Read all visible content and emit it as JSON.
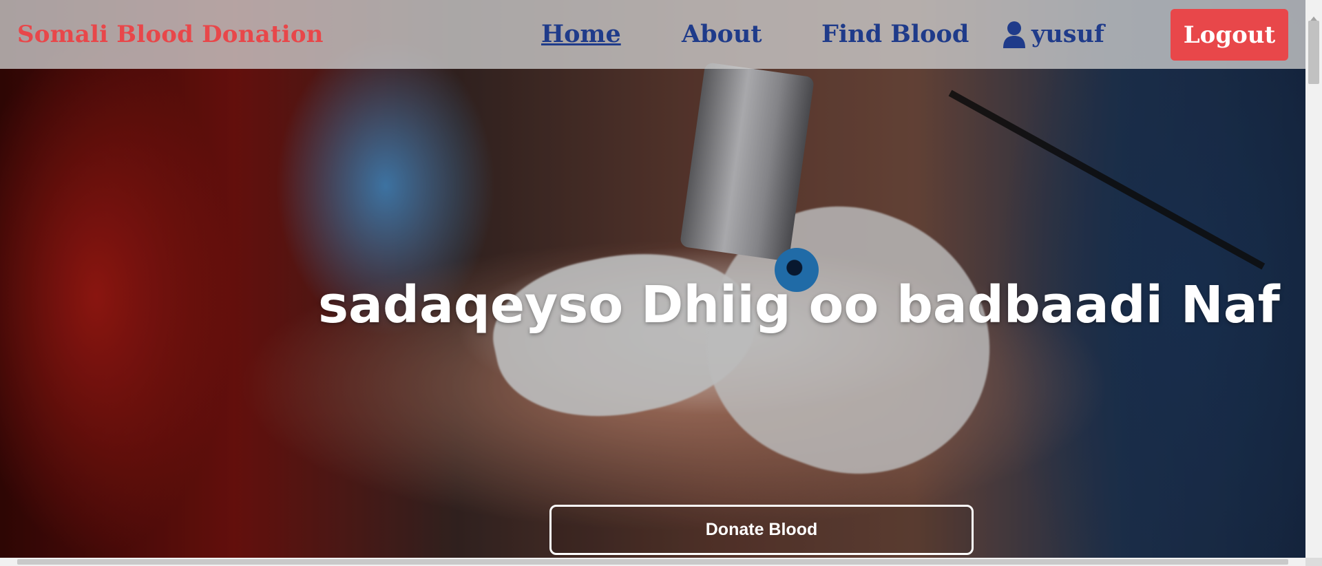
{
  "nav": {
    "brand": "Somali Blood Donation",
    "links": [
      "Home",
      "About",
      "Find Blood"
    ],
    "active": "Home",
    "user": "yusuf",
    "logout_label": "Logout"
  },
  "hero": {
    "tagline": "sadaqeyso Dhiig oo badbaadi Naf",
    "cta_label": "Donate Blood",
    "background_image": "blood-donation-arm-photo"
  },
  "icons": {
    "user": "user-icon"
  },
  "colors": {
    "brand": "#e8474a",
    "nav_text": "#1f3b8a",
    "logout_bg": "#e8474a",
    "tagline": "#ffffff"
  }
}
